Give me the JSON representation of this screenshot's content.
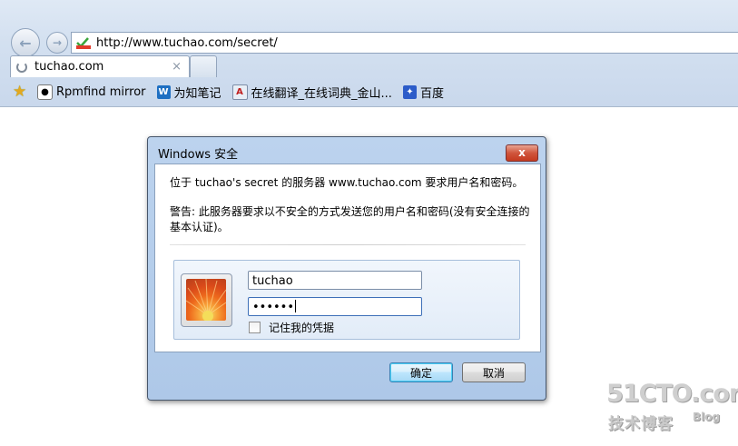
{
  "browser": {
    "url": "http://www.tuchao.com/secret/",
    "tab_title": "tuchao.com",
    "tab_close": "×",
    "favorites": [
      {
        "label": "Rpmfind mirror",
        "icon": "tux-icon"
      },
      {
        "label": "为知笔记",
        "icon": "wiz-icon"
      },
      {
        "label": "在线翻译_在线词典_金山...",
        "icon": "dictionary-icon"
      },
      {
        "label": "百度",
        "icon": "baidu-paw-icon"
      }
    ]
  },
  "dialog": {
    "title": "Windows 安全",
    "close_label": "x",
    "message": "位于 tuchao's secret 的服务器 www.tuchao.com 要求用户名和密码。",
    "warning": "警告: 此服务器要求以不安全的方式发送您的用户名和密码(没有安全连接的基本认证)。",
    "username_value": "tuchao",
    "password_value": "••••••",
    "remember_label": "记住我的凭据",
    "remember_checked": false,
    "ok_label": "确定",
    "cancel_label": "取消"
  },
  "watermark": {
    "main": "51CTO.com",
    "sub": "技术博客",
    "blog": "Blog"
  },
  "colors": {
    "chrome_bg": "#d3e0f0",
    "dialog_frame": "#aec8e8",
    "close_red": "#c53a1f",
    "ok_border": "#3c7fb1"
  }
}
